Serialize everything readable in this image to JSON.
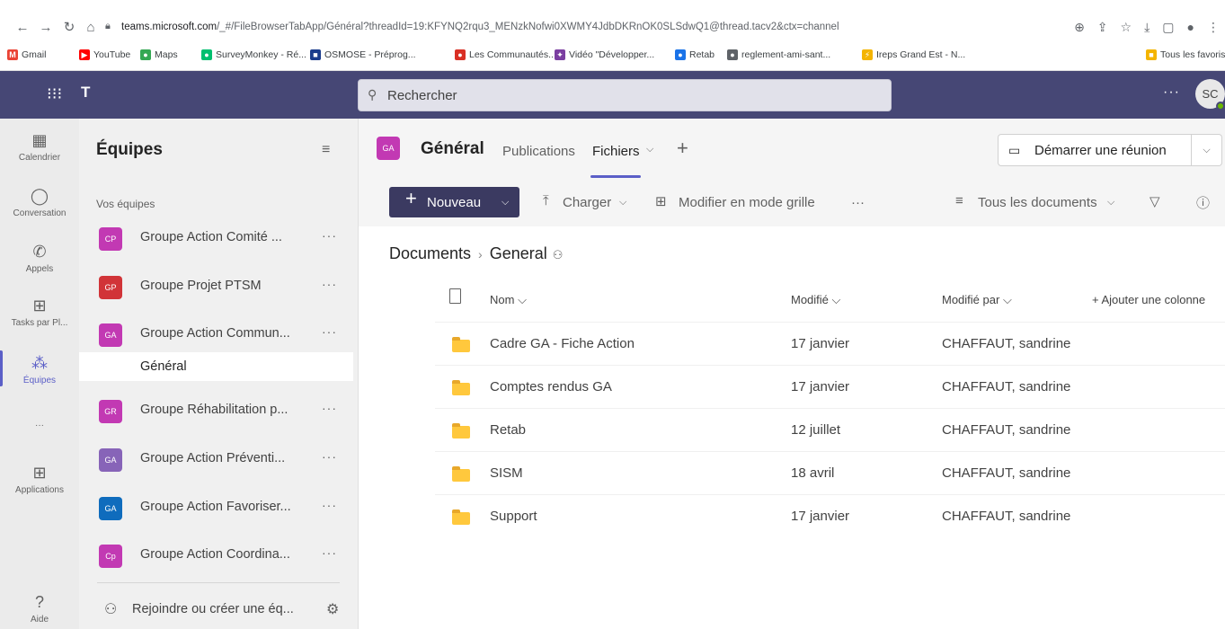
{
  "browser": {
    "url_host": "teams.microsoft.com",
    "url_path": "/_#/FileBrowserTabApp/Général?threadId=19:KFYNQ2rqu3_MENzkNofwi0XWMY4JdbDKRnOK0SLSdwQ1@thread.tacv2&ctx=channel",
    "bookmarks": [
      {
        "label": "Gmail",
        "color": "#ea4335",
        "glyph": "M"
      },
      {
        "label": "YouTube",
        "color": "#ff0000",
        "glyph": "▶"
      },
      {
        "label": "Maps",
        "color": "#34a853",
        "glyph": "●"
      },
      {
        "label": "SurveyMonkey - Ré...",
        "color": "#00bf6f",
        "glyph": "●"
      },
      {
        "label": "OSMOSE - Préprog...",
        "color": "#1a3c8c",
        "glyph": "■"
      },
      {
        "label": "Les Communautés...",
        "color": "#d93025",
        "glyph": "●"
      },
      {
        "label": "Vidéo \"Développer...",
        "color": "#7b3fa1",
        "glyph": "✦"
      },
      {
        "label": "Retab",
        "color": "#1a73e8",
        "glyph": "●"
      },
      {
        "label": "reglement-ami-sant...",
        "color": "#5f6368",
        "glyph": "●"
      },
      {
        "label": "Ireps Grand Est - N...",
        "color": "#f4b400",
        "glyph": "⚡"
      },
      {
        "label": "Tous les favoris",
        "color": "#f4b400",
        "glyph": "■"
      }
    ]
  },
  "teams_bar": {
    "search_placeholder": "Rechercher",
    "avatar_initials": "SC",
    "more": "···"
  },
  "rail": [
    {
      "label": "Calendrier",
      "icon": "calendar-icon",
      "glyph": "▦"
    },
    {
      "label": "Conversation",
      "icon": "chat-icon",
      "glyph": "◯"
    },
    {
      "label": "Appels",
      "icon": "phone-icon",
      "glyph": "✆"
    },
    {
      "label": "Tasks par Pl...",
      "icon": "tasks-icon",
      "glyph": "⊞"
    },
    {
      "label": "Équipes",
      "icon": "teams-icon",
      "glyph": "⁂"
    },
    {
      "label": "···",
      "icon": "more-icon",
      "glyph": ""
    },
    {
      "label": "Applications",
      "icon": "apps-icon",
      "glyph": "⊞"
    },
    {
      "label": "Aide",
      "icon": "help-icon",
      "glyph": "?"
    }
  ],
  "teams_pane": {
    "title": "Équipes",
    "section": "Vos équipes",
    "teams": [
      {
        "initials": "CP",
        "name": "Groupe Action Comité ...",
        "color": "#c239b3"
      },
      {
        "initials": "GP",
        "name": "Groupe Projet PTSM",
        "color": "#d13438"
      },
      {
        "initials": "GA",
        "name": "Groupe Action Commun...",
        "color": "#c239b3"
      },
      {
        "initials": "GR",
        "name": "Groupe Réhabilitation p...",
        "color": "#c239b3"
      },
      {
        "initials": "GA",
        "name": "Groupe Action Préventi...",
        "color": "#8764b8"
      },
      {
        "initials": "GA",
        "name": "Groupe Action Favoriser...",
        "color": "#0f6cbd"
      },
      {
        "initials": "Cp",
        "name": "Groupe Action Coordina...",
        "color": "#c239b3"
      }
    ],
    "active_channel": "Général",
    "join_label": "Rejoindre ou créer une éq..."
  },
  "channel": {
    "avatar_initials": "GA",
    "title": "Général",
    "tabs": [
      "Publications",
      "Fichiers"
    ],
    "meet_label": "Démarrer une réunion"
  },
  "toolbar": {
    "new_label": "Nouveau",
    "upload_label": "Charger",
    "grid_label": "Modifier en mode grille",
    "more": "···",
    "view_label": "Tous les documents"
  },
  "breadcrumb": {
    "root": "Documents",
    "current": "General"
  },
  "columns": {
    "name": "Nom",
    "modified": "Modifié",
    "modified_by": "Modifié par",
    "add_column": "+ Ajouter une colonne"
  },
  "files": [
    {
      "name": "Cadre GA - Fiche Action",
      "modified": "17 janvier",
      "by": "CHAFFAUT, sandrine"
    },
    {
      "name": "Comptes rendus GA",
      "modified": "17 janvier",
      "by": "CHAFFAUT, sandrine"
    },
    {
      "name": "Retab",
      "modified": "12 juillet",
      "by": "CHAFFAUT, sandrine"
    },
    {
      "name": "SISM",
      "modified": "18 avril",
      "by": "CHAFFAUT, sandrine"
    },
    {
      "name": "Support",
      "modified": "17 janvier",
      "by": "CHAFFAUT, sandrine"
    }
  ]
}
